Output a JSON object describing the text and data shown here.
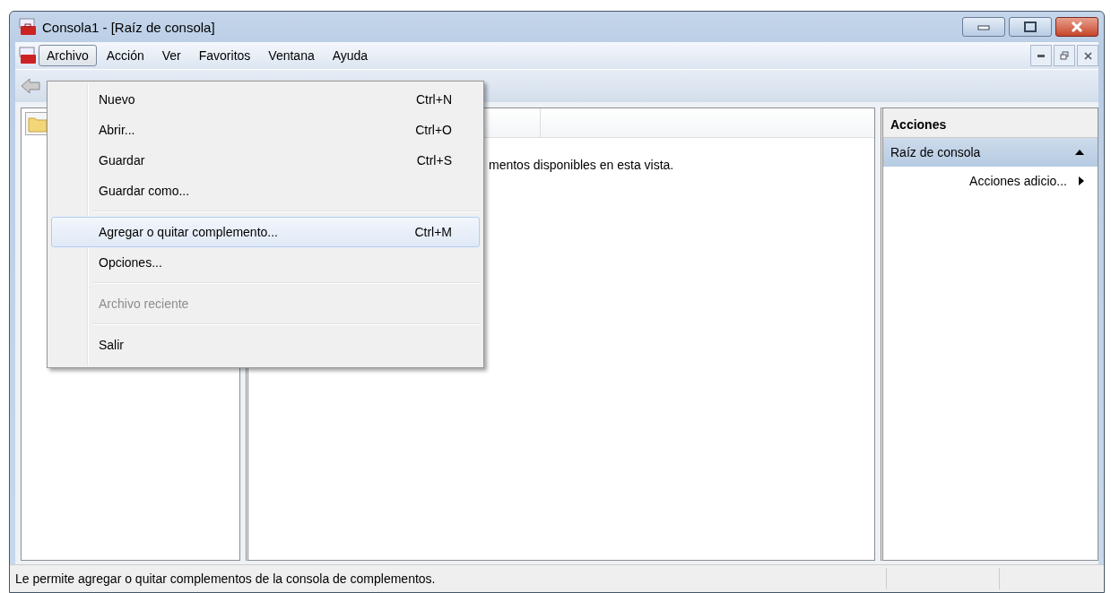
{
  "window": {
    "title": "Consola1 - [Raíz de consola]"
  },
  "menu_bar": [
    {
      "label": "Archivo",
      "selected": true
    },
    {
      "label": "Acción",
      "selected": false
    },
    {
      "label": "Ver",
      "selected": false
    },
    {
      "label": "Favoritos",
      "selected": false
    },
    {
      "label": "Ventana",
      "selected": false
    },
    {
      "label": "Ayuda",
      "selected": false
    }
  ],
  "file_menu": [
    {
      "kind": "item",
      "label": "Nuevo",
      "shortcut": "Ctrl+N",
      "selected": false,
      "disabled": false
    },
    {
      "kind": "item",
      "label": "Abrir...",
      "shortcut": "Ctrl+O",
      "selected": false,
      "disabled": false
    },
    {
      "kind": "item",
      "label": "Guardar",
      "shortcut": "Ctrl+S",
      "selected": false,
      "disabled": false
    },
    {
      "kind": "item",
      "label": "Guardar como...",
      "selected": false,
      "disabled": false
    },
    {
      "kind": "separator"
    },
    {
      "kind": "item",
      "label": "Agregar o quitar complemento...",
      "shortcut": "Ctrl+M",
      "selected": true,
      "disabled": false
    },
    {
      "kind": "item",
      "label": "Opciones...",
      "selected": false,
      "disabled": false
    },
    {
      "kind": "separator"
    },
    {
      "kind": "item",
      "label": "Archivo reciente",
      "selected": false,
      "disabled": true
    },
    {
      "kind": "separator"
    },
    {
      "kind": "item",
      "label": "Salir",
      "selected": false,
      "disabled": false
    }
  ],
  "content": {
    "message": "mentos disponibles en esta vista."
  },
  "actions": {
    "title": "Acciones",
    "section": {
      "label": "Raíz de consola",
      "expanded": true
    },
    "items": [
      {
        "label": "Acciones adicio..."
      }
    ]
  },
  "status_bar": {
    "text": "Le permite agregar o quitar complementos de la consola de complementos."
  }
}
